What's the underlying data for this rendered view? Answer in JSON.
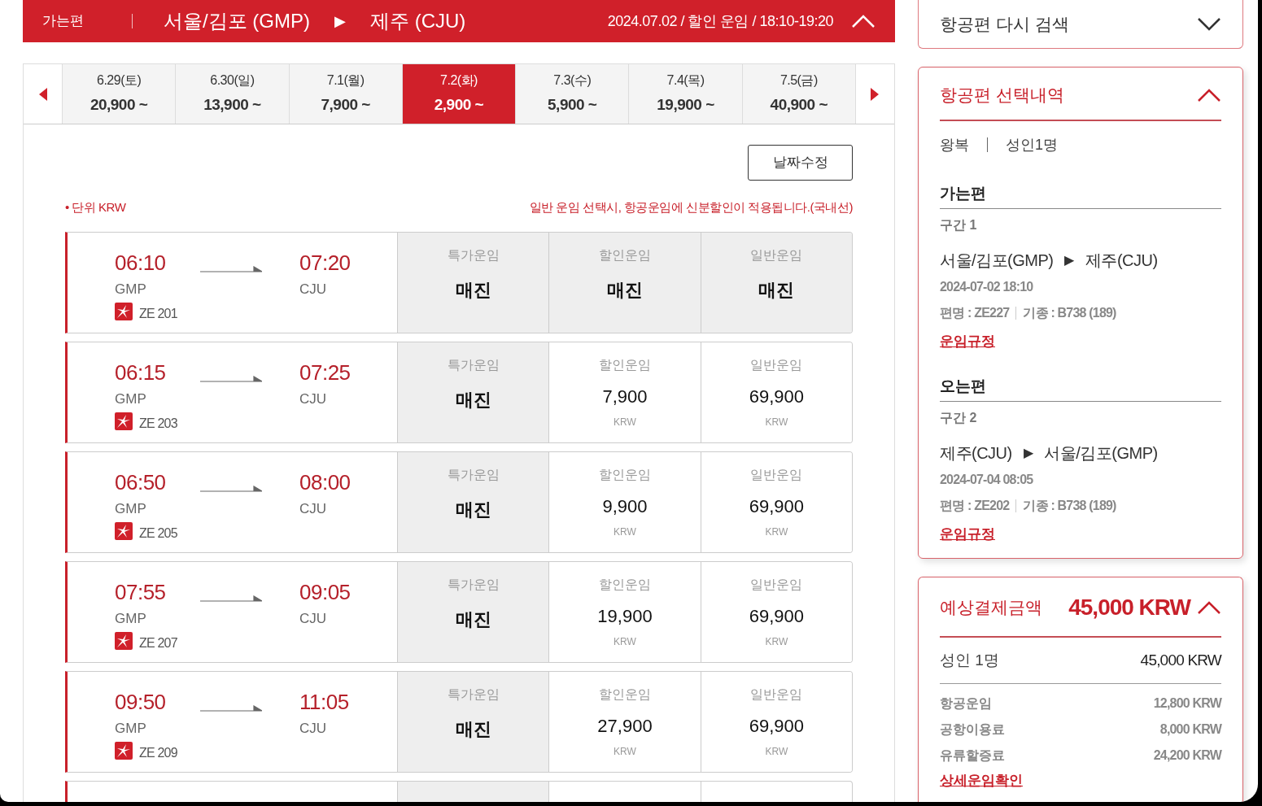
{
  "header": {
    "leg": "가는편",
    "from": "서울/김포 (GMP)",
    "arrow": "▶",
    "to": "제주 (CJU)",
    "summary": "2024.07.02 / 할인 운임 / 18:10-19:20"
  },
  "dates": [
    {
      "date": "6.29(토)",
      "price": "20,900 ~",
      "selected": false
    },
    {
      "date": "6.30(일)",
      "price": "13,900 ~",
      "selected": false
    },
    {
      "date": "7.1(월)",
      "price": "7,900 ~",
      "selected": false
    },
    {
      "date": "7.2(화)",
      "price": "2,900 ~",
      "selected": true
    },
    {
      "date": "7.3(수)",
      "price": "5,900 ~",
      "selected": false
    },
    {
      "date": "7.4(목)",
      "price": "19,900 ~",
      "selected": false
    },
    {
      "date": "7.5(금)",
      "price": "40,900 ~",
      "selected": false
    }
  ],
  "change_date_button": "날짜수정",
  "unit_note": "• 단위 KRW",
  "discount_note": "일반 운임 선택시, 항공운임에 신분할인이 적용됩니다.(국내선)",
  "flights": [
    {
      "dep": "06:10",
      "dep_code": "GMP",
      "arr": "07:20",
      "arr_code": "CJU",
      "flight_no": "ZE 201",
      "fares": [
        {
          "label": "특가운임",
          "kind": "soldout",
          "text": "매진"
        },
        {
          "label": "할인운임",
          "kind": "soldout",
          "text": "매진"
        },
        {
          "label": "일반운임",
          "kind": "soldout",
          "text": "매진"
        }
      ]
    },
    {
      "dep": "06:15",
      "dep_code": "GMP",
      "arr": "07:25",
      "arr_code": "CJU",
      "flight_no": "ZE 203",
      "fares": [
        {
          "label": "특가운임",
          "kind": "soldout",
          "text": "매진"
        },
        {
          "label": "할인운임",
          "kind": "price",
          "text": "7,900",
          "currency": "KRW"
        },
        {
          "label": "일반운임",
          "kind": "price",
          "text": "69,900",
          "currency": "KRW"
        }
      ]
    },
    {
      "dep": "06:50",
      "dep_code": "GMP",
      "arr": "08:00",
      "arr_code": "CJU",
      "flight_no": "ZE 205",
      "fares": [
        {
          "label": "특가운임",
          "kind": "soldout",
          "text": "매진"
        },
        {
          "label": "할인운임",
          "kind": "price",
          "text": "9,900",
          "currency": "KRW"
        },
        {
          "label": "일반운임",
          "kind": "price",
          "text": "69,900",
          "currency": "KRW"
        }
      ]
    },
    {
      "dep": "07:55",
      "dep_code": "GMP",
      "arr": "09:05",
      "arr_code": "CJU",
      "flight_no": "ZE 207",
      "fares": [
        {
          "label": "특가운임",
          "kind": "soldout",
          "text": "매진"
        },
        {
          "label": "할인운임",
          "kind": "price",
          "text": "19,900",
          "currency": "KRW"
        },
        {
          "label": "일반운임",
          "kind": "price",
          "text": "69,900",
          "currency": "KRW"
        }
      ]
    },
    {
      "dep": "09:50",
      "dep_code": "GMP",
      "arr": "11:05",
      "arr_code": "CJU",
      "flight_no": "ZE 209",
      "fares": [
        {
          "label": "특가운임",
          "kind": "soldout",
          "text": "매진"
        },
        {
          "label": "할인운임",
          "kind": "price",
          "text": "27,900",
          "currency": "KRW"
        },
        {
          "label": "일반운임",
          "kind": "price",
          "text": "69,900",
          "currency": "KRW"
        }
      ]
    }
  ],
  "research": {
    "title": "항공편 다시 검색",
    "expanded": false
  },
  "selection": {
    "title": "항공편 선택내역",
    "expanded": true,
    "trip": "왕복",
    "pax": "성인1명",
    "legs": [
      {
        "heading": "가는편",
        "segment": "구간 1",
        "from": "서울/김포(GMP)",
        "arrow": "▶",
        "to": "제주(CJU)",
        "datetime": "2024-07-02 18:10",
        "flight": "편명 : ZE227",
        "aircraft": "기종 : B738 (189)",
        "rules_link": "운임규정"
      },
      {
        "heading": "오는편",
        "segment": "구간 2",
        "from": "제주(CJU)",
        "arrow": "▶",
        "to": "서울/김포(GMP)",
        "datetime": "2024-07-04 08:05",
        "flight": "편명 : ZE202",
        "aircraft": "기종 : B738 (189)",
        "rules_link": "운임규정"
      }
    ]
  },
  "payment": {
    "title": "예상결제금액",
    "total": "45,000 KRW",
    "expanded": true,
    "pax_label": "성인 1명",
    "pax_amount": "45,000 KRW",
    "items": [
      {
        "label": "항공운임",
        "amount": "12,800 KRW"
      },
      {
        "label": "공항이용료",
        "amount": "8,000 KRW"
      },
      {
        "label": "유류할증료",
        "amount": "24,200 KRW"
      }
    ],
    "detail_link": "상세운임확인"
  }
}
